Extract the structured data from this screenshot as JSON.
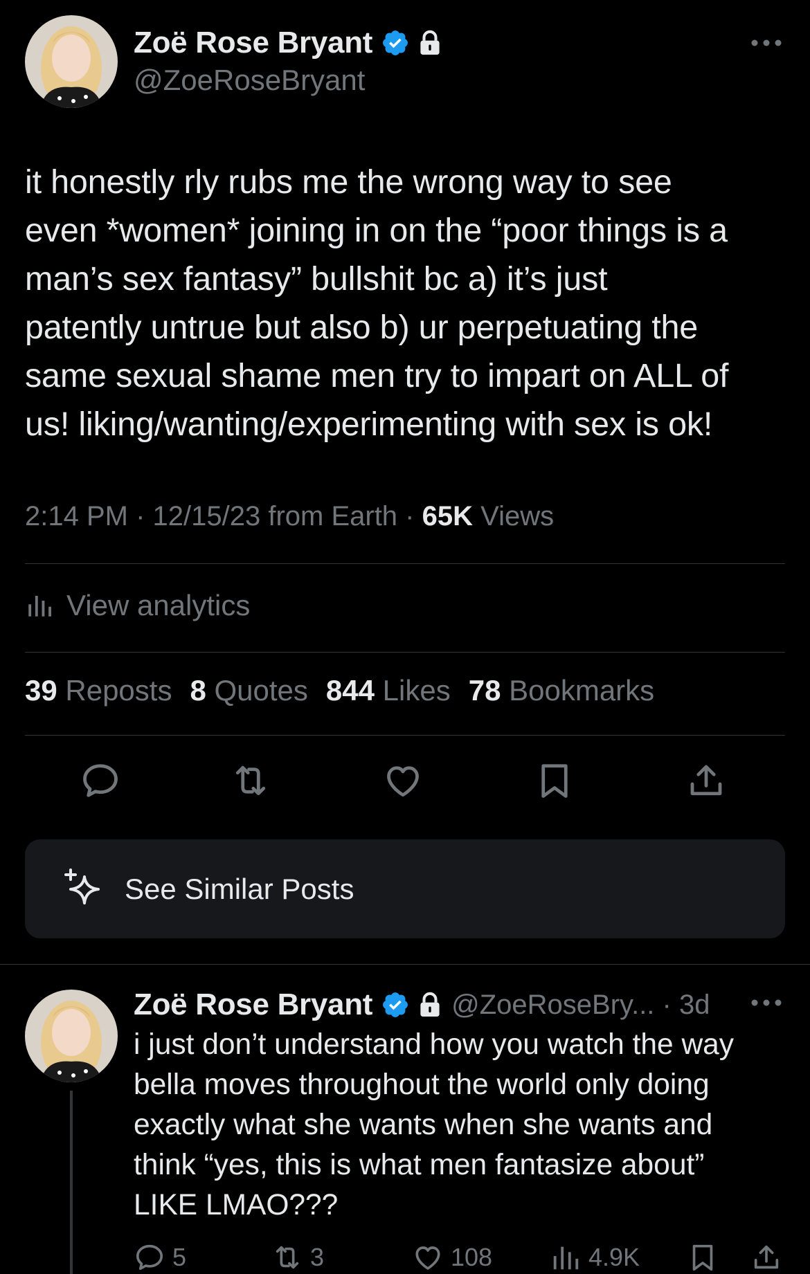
{
  "post": {
    "author": {
      "display_name": "Zoë Rose Bryant",
      "handle": "@ZoeRoseBryant",
      "verified": true,
      "protected": true
    },
    "text_lines": [
      "it honestly rly rubs me the wrong way to see",
      "even *women* joining in on the “poor things is a",
      "man’s sex fantasy” bullshit bc a) it’s just",
      "patently untrue but also b) ur perpetuating the",
      "same sexual shame men try to impart on ALL of",
      "us! liking/wanting/experimenting with sex is ok!"
    ],
    "meta": {
      "time": "2:14 PM",
      "sep1": " · ",
      "date": "12/15/23",
      "source": " from Earth",
      "sep2": " · ",
      "views_count": "65K",
      "views_label": " Views"
    },
    "analytics_label": "View analytics",
    "stats": [
      {
        "count": "39",
        "label": " Reposts"
      },
      {
        "count": "8",
        "label": " Quotes"
      },
      {
        "count": "844",
        "label": " Likes"
      },
      {
        "count": "78",
        "label": " Bookmarks"
      }
    ],
    "actions": [
      "reply-icon",
      "repost-icon",
      "like-icon",
      "bookmark-icon",
      "share-icon"
    ]
  },
  "similar_posts": {
    "label": "See Similar Posts",
    "icon": "sparkle-icon"
  },
  "reply": {
    "author": {
      "display_name": "Zoë Rose Bryant",
      "handle_time": "@ZoeRoseBry... · 3d",
      "verified": true,
      "protected": true
    },
    "text_lines": [
      "i just don’t understand how you watch the way",
      "bella moves throughout the world only doing",
      "exactly what she wants when she wants and",
      "think “yes, this is what men fantasize about”",
      "LIKE LMAO???"
    ],
    "actions": {
      "replies": "5",
      "reposts": "3",
      "likes": "108",
      "views": "4.9K"
    }
  },
  "colors": {
    "background": "#000000",
    "text_primary": "#e7e9ea",
    "text_secondary": "#71767b",
    "verified_blue": "#1d9bf0",
    "divider": "#2f3336",
    "card_bg": "#16181c"
  }
}
